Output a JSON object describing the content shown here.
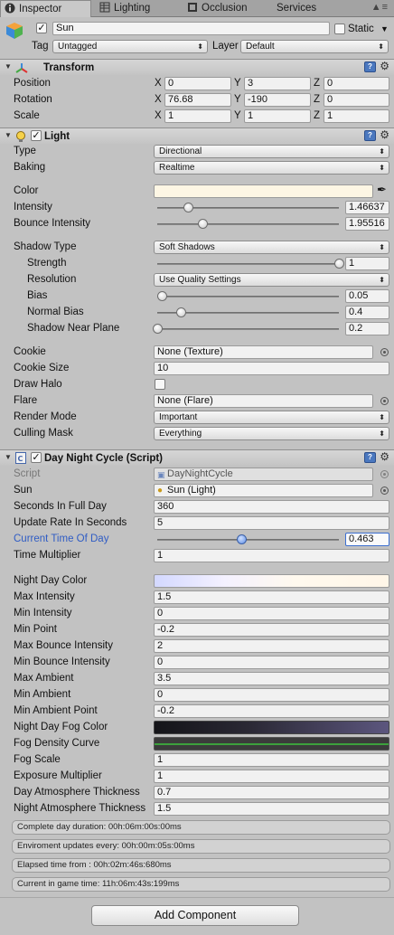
{
  "tabs": {
    "inspector": "Inspector",
    "lighting": "Lighting",
    "occlusion": "Occlusion",
    "services": "Services",
    "menu": "▲≡"
  },
  "object": {
    "name": "Sun",
    "static_label": "Static",
    "tag_label": "Tag",
    "tag_value": "Untagged",
    "layer_label": "Layer",
    "layer_value": "Default"
  },
  "transform": {
    "title": "Transform",
    "position": {
      "label": "Position",
      "x": "0",
      "y": "3",
      "z": "0"
    },
    "rotation": {
      "label": "Rotation",
      "x": "76.68",
      "y": "-190",
      "z": "0"
    },
    "scale": {
      "label": "Scale",
      "x": "1",
      "y": "1",
      "z": "1"
    },
    "axes": {
      "x": "X",
      "y": "Y",
      "z": "Z"
    }
  },
  "light": {
    "title": "Light",
    "type_label": "Type",
    "type_value": "Directional",
    "baking_label": "Baking",
    "baking_value": "Realtime",
    "color_label": "Color",
    "color_hex": "#fdf6e4",
    "intensity_label": "Intensity",
    "intensity_value": "1.46637",
    "intensity_fraction": 0.17,
    "bounce_label": "Bounce Intensity",
    "bounce_value": "1.95516",
    "bounce_fraction": 0.25,
    "shadow_type_label": "Shadow Type",
    "shadow_type_value": "Soft Shadows",
    "strength_label": "Strength",
    "strength_value": "1",
    "strength_fraction": 1.0,
    "resolution_label": "Resolution",
    "resolution_value": "Use Quality Settings",
    "bias_label": "Bias",
    "bias_value": "0.05",
    "bias_fraction": 0.025,
    "normal_bias_label": "Normal Bias",
    "normal_bias_value": "0.4",
    "normal_bias_fraction": 0.13,
    "near_plane_label": "Shadow Near Plane",
    "near_plane_value": "0.2",
    "near_plane_fraction": 0.0,
    "cookie_label": "Cookie",
    "cookie_value": "None (Texture)",
    "cookie_size_label": "Cookie Size",
    "cookie_size_value": "10",
    "draw_halo_label": "Draw Halo",
    "flare_label": "Flare",
    "flare_value": "None (Flare)",
    "render_mode_label": "Render Mode",
    "render_mode_value": "Important",
    "culling_label": "Culling Mask",
    "culling_value": "Everything"
  },
  "cycle": {
    "title": "Day Night Cycle (Script)",
    "script_label": "Script",
    "script_value": "DayNightCycle",
    "sun_label": "Sun",
    "sun_value": "Sun (Light)",
    "seconds_label": "Seconds In Full Day",
    "seconds_value": "360",
    "update_label": "Update Rate In Seconds",
    "update_value": "5",
    "current_label": "Current Time Of Day",
    "current_value": "0.463",
    "current_fraction": 0.463,
    "time_mult_label": "Time Multiplier",
    "time_mult_value": "1",
    "night_day_color_label": "Night Day Color",
    "max_int_label": "Max Intensity",
    "max_int_value": "1.5",
    "min_int_label": "Min Intensity",
    "min_int_value": "0",
    "min_point_label": "Min Point",
    "min_point_value": "-0.2",
    "max_bounce_label": "Max Bounce Intensity",
    "max_bounce_value": "2",
    "min_bounce_label": "Min Bounce Intensity",
    "min_bounce_value": "0",
    "max_amb_label": "Max Ambient",
    "max_amb_value": "3.5",
    "min_amb_label": "Min Ambient",
    "min_amb_value": "0",
    "min_amb_point_label": "Min Ambient Point",
    "min_amb_point_value": "-0.2",
    "fog_color_label": "Night Day Fog Color",
    "fog_curve_label": "Fog Density Curve",
    "fog_scale_label": "Fog Scale",
    "fog_scale_value": "1",
    "exposure_label": "Exposure Multiplier",
    "exposure_value": "1",
    "day_atm_label": "Day Atmosphere Thickness",
    "day_atm_value": "0.7",
    "night_atm_label": "Night Atmosphere Thickness",
    "night_atm_value": "1.5",
    "info": [
      "Complete day duration: 00h:06m:00s:00ms",
      "Enviroment updates every: 00h:00m:05s:00ms",
      "Elapsed time from : 00h:02m:46s:680ms",
      "Current in game time: 11h:06m:43s:199ms"
    ]
  },
  "add_component": "Add Component"
}
